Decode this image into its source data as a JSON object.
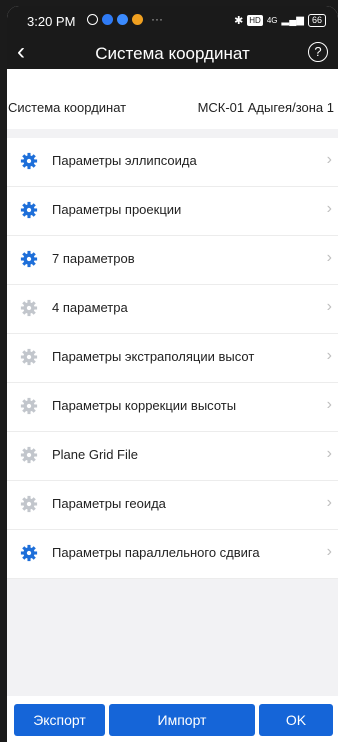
{
  "status_bar": {
    "time": "3:20 PM",
    "more": "···",
    "signal_text": "4G",
    "battery": "66"
  },
  "header": {
    "back_icon": "chevron-left-icon",
    "title": "Система координат",
    "help_icon": "help-circle-icon"
  },
  "coordinate_system": {
    "label": "Система координат",
    "value": "МСК-01 Адыгея/зона 1"
  },
  "colors": {
    "accent": "#1565d8",
    "gear_active": "#1e6fd9",
    "gear_inactive": "#c2c6cc",
    "topbar": "#1a1a1a"
  },
  "menu": [
    {
      "label": "Параметры эллипсоида",
      "active": true,
      "icon": "gear-icon"
    },
    {
      "label": "Параметры проекции",
      "active": true,
      "icon": "gear-icon"
    },
    {
      "label": "7 параметров",
      "active": true,
      "icon": "gear-icon"
    },
    {
      "label": "4 параметра",
      "active": false,
      "icon": "gear-icon"
    },
    {
      "label": "Параметры экстраполяции высот",
      "active": false,
      "icon": "gear-icon"
    },
    {
      "label": "Параметры коррекции высоты",
      "active": false,
      "icon": "gear-icon"
    },
    {
      "label": "Plane Grid File",
      "active": false,
      "icon": "gear-icon"
    },
    {
      "label": "Параметры геоида",
      "active": false,
      "icon": "gear-icon"
    },
    {
      "label": "Параметры параллельного сдвига",
      "active": true,
      "icon": "gear-icon"
    }
  ],
  "buttons": {
    "export": "Экспорт",
    "import": "Импорт",
    "ok": "OK"
  }
}
